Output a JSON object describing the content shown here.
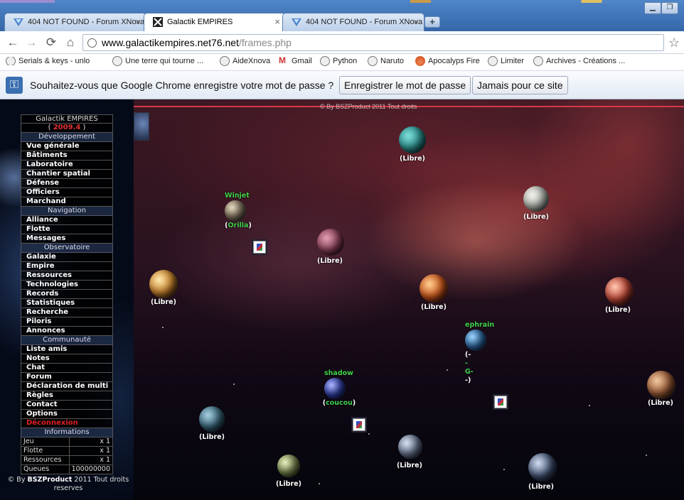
{
  "browser": {
    "tabs": [
      {
        "title": "404 NOT FOUND - Forum XNova"
      },
      {
        "title": "Galactik EMPIRES"
      },
      {
        "title": "404 NOT FOUND - Forum XNova"
      }
    ],
    "url_host": "www.galactikempires.net76.net",
    "url_path": "/frames.php",
    "bookmarks": [
      "Serials & keys - unlock",
      "Une terre qui tourne ...",
      "AideXnova",
      "Gmail",
      "Python",
      "Naruto",
      "Apocalyps Fire",
      "Limiter",
      "Archives - Créations ..."
    ],
    "infobar": {
      "message": "Souhaitez-vous que Google Chrome enregistre votre mot de passe ?",
      "save_label": "Enregistrer le mot de passe",
      "never_label": "Jamais pour ce site"
    }
  },
  "game": {
    "title": "Galactik EMPIRES",
    "version": "2009.4",
    "top_text": "© By BSZProduct 2011 Tout droits",
    "sections": {
      "developpement": "Développement",
      "navigation": "Navigation",
      "observatoire": "Observatoire",
      "communaute": "Communauté",
      "informations": "Informations"
    },
    "menu_dev": [
      "Vue générale",
      "Bâtiments",
      "Laboratoire",
      "Chantier spatial",
      "Défense",
      "Officiers",
      "Marchand"
    ],
    "menu_nav": [
      "Alliance",
      "Flotte",
      "Messages"
    ],
    "menu_obs": [
      "Galaxie",
      "Empire",
      "Ressources",
      "Technologies",
      "Records",
      "Statistiques",
      "Recherche",
      "Piloris",
      "Annonces"
    ],
    "menu_com": [
      "Liste amis",
      "Notes",
      "Chat",
      "Forum",
      "Déclaration de multi",
      "Règles",
      "Contact",
      "Options"
    ],
    "logout": "Déconnexion",
    "info_rows": [
      {
        "label": "Jeu",
        "value": "x 1"
      },
      {
        "label": "Flotte",
        "value": "x 1"
      },
      {
        "label": "Ressources",
        "value": "x 1"
      },
      {
        "label": "Queues",
        "value": "100000000"
      }
    ],
    "footer_prefix": "© By ",
    "footer_brand": "BSZProduct",
    "footer_suffix": " 2011 Tout droits reserves",
    "planets": {
      "free_label": "(Libre)",
      "winjet_owner": "Winjet",
      "winjet_name": "Orilla",
      "shadow_owner": "shadow",
      "shadow_name": "coucou",
      "ephrain_owner": "ephrain",
      "ephrain_lines": [
        "(-",
        "-",
        "G-",
        "-)"
      ]
    }
  },
  "colors": {
    "accent_green": "#3fd04a",
    "logout_red": "#e02020",
    "version_red": "#e03030"
  }
}
